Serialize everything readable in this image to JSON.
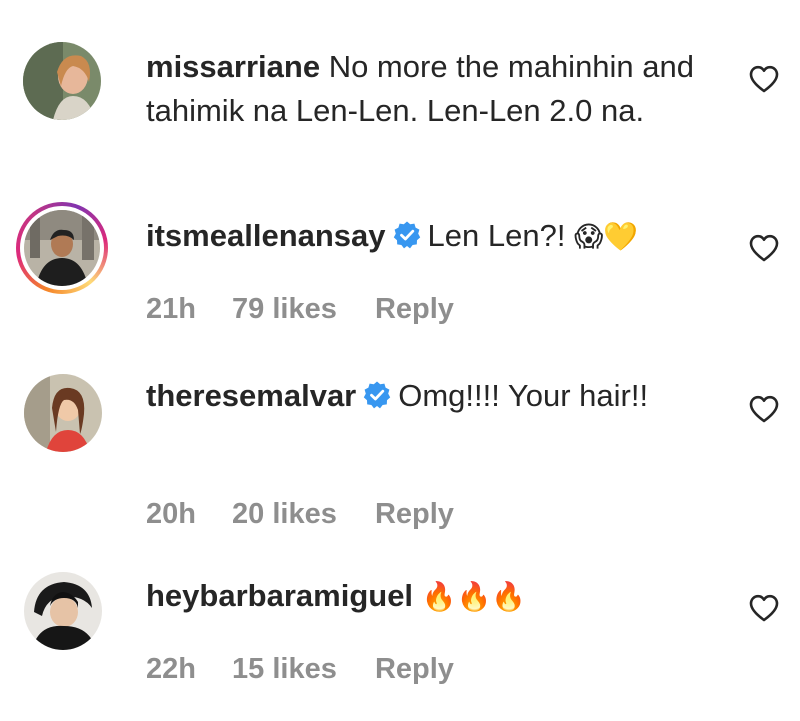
{
  "comments": [
    {
      "username": "missarriane",
      "verified": false,
      "text": "No more the mahinhin and tahimik na Len-Len. Len-Len 2.0 na.",
      "emoji": ""
    },
    {
      "username": "itsmeallenansay",
      "verified": true,
      "text": "Len Len?!",
      "emoji": "😱💛",
      "time": "21h",
      "likes": "79 likes",
      "reply": "Reply"
    },
    {
      "username": "theresemalvar",
      "verified": true,
      "text": "Omg!!!! Your hair!!",
      "emoji": "",
      "time": "20h",
      "likes": "20 likes",
      "reply": "Reply"
    },
    {
      "username": "heybarbaramiguel",
      "verified": false,
      "text": "",
      "emoji": "🔥🔥🔥",
      "time": "22h",
      "likes": "15 likes",
      "reply": "Reply"
    }
  ],
  "colors": {
    "text": "#262626",
    "meta": "#8e8e8e",
    "verified_badge": "#3897f0"
  },
  "icons": {
    "like": "heart-outline-icon",
    "verified": "verified-badge-icon"
  }
}
